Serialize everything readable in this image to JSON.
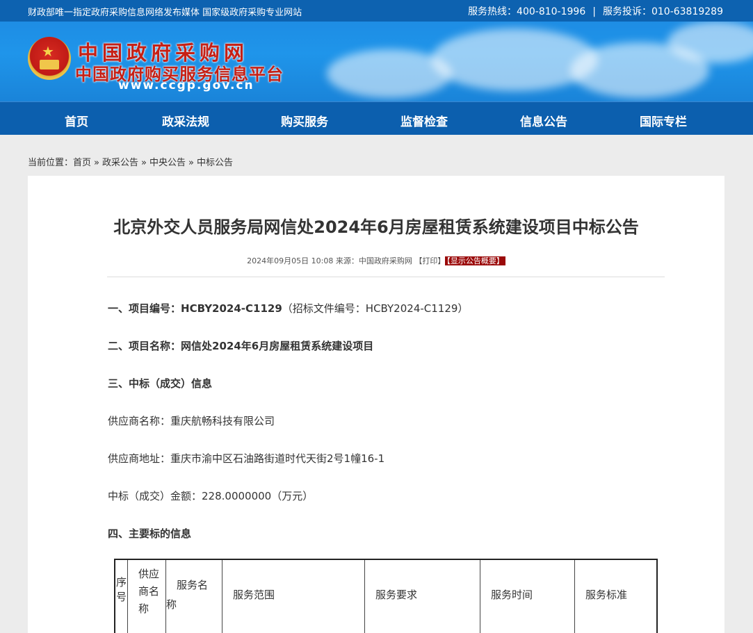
{
  "topbar": {
    "slogan": "财政部唯一指定政府采购信息网络发布媒体 国家级政府采购专业网站",
    "hotline": "服务热线：400-810-1996",
    "separator": "|",
    "complaint": "服务投诉：010-63819289"
  },
  "banner": {
    "site_name": "中国政府采购网",
    "site_subtitle": "中国政府购买服务信息平台",
    "site_url": "www.ccgp.gov.cn"
  },
  "nav": {
    "items": [
      "首页",
      "政采法规",
      "购买服务",
      "监督检查",
      "信息公告",
      "国际专栏"
    ]
  },
  "breadcrumb": {
    "label": "当前位置：",
    "items": [
      "首页",
      "政采公告",
      "中央公告",
      "中标公告"
    ],
    "sep": "»"
  },
  "article": {
    "title": "北京外交人员服务局网信处2024年6月房屋租赁系统建设项目中标公告",
    "meta": {
      "datetime": "2024年09月05日 10:08",
      "source": "来源：中国政府采购网",
      "print": "【打印】",
      "overview": "【显示公告概要】"
    },
    "sections": {
      "s1_label": "一、项目编号：",
      "s1_value": "HCBY2024-C1129",
      "s1_note": "（招标文件编号：HCBY2024-C1129）",
      "s2_label": "二、项目名称：",
      "s2_value": "网信处2024年6月房屋租赁系统建设项目",
      "s3_label": "三、中标（成交）信息",
      "supplier_name": "供应商名称：重庆航畅科技有限公司",
      "supplier_addr": "供应商地址：重庆市渝中区石油路街道时代天街2号1幢16-1",
      "amount": "中标（成交）金额：228.0000000（万元）",
      "s4_label": "四、主要标的信息"
    },
    "table": {
      "headers": [
        "序号",
        "供应商名称",
        "服务名称",
        "服务范围",
        "服务要求",
        "服务时间",
        "服务标准"
      ]
    }
  }
}
